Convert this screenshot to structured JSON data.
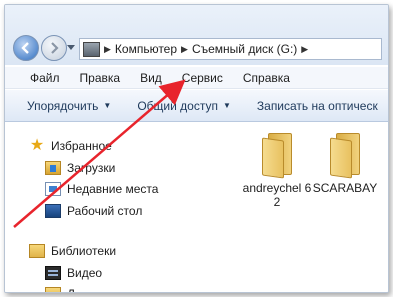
{
  "address": {
    "segments": [
      "Компьютер",
      "Съемный диск (G:)"
    ]
  },
  "menu": {
    "items": [
      "Файл",
      "Правка",
      "Вид",
      "Сервис",
      "Справка"
    ]
  },
  "commandbar": {
    "organize": "Упорядочить",
    "share": "Общий доступ",
    "burn": "Записать на оптическ"
  },
  "navpane": {
    "favorites": "Избранное",
    "downloads": "Загрузки",
    "recent": "Недавние места",
    "desktop": "Рабочий стол",
    "libraries": "Библиотеки",
    "video": "Видео",
    "next_partial": "Д"
  },
  "content": {
    "items": [
      {
        "label": "andreychel 62"
      },
      {
        "label": "SCARABAY"
      }
    ]
  },
  "annotation": {
    "arrow_color": "#e8242c"
  }
}
